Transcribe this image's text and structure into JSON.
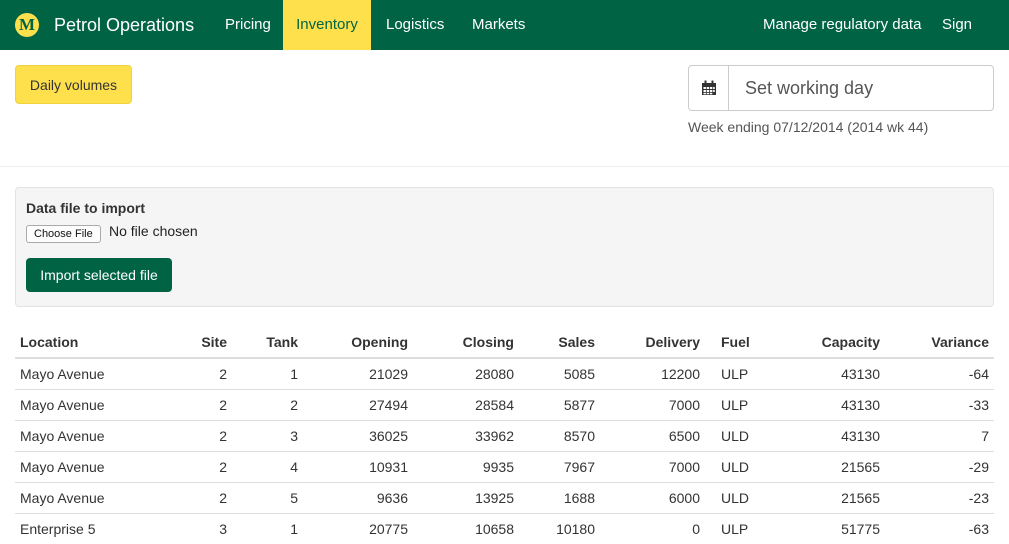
{
  "nav": {
    "logo_letter": "M",
    "brand": "Petrol Operations",
    "items": [
      {
        "label": "Pricing",
        "active": false
      },
      {
        "label": "Inventory",
        "active": true
      },
      {
        "label": "Logistics",
        "active": false
      },
      {
        "label": "Markets",
        "active": false
      }
    ],
    "right": [
      {
        "label": "Manage regulatory data"
      },
      {
        "label": "Sign out"
      }
    ],
    "colors": {
      "bar": "#006444",
      "accent": "#fee04d"
    }
  },
  "toolbar": {
    "daily_volumes_label": "Daily volumes",
    "calendar_icon": "calendar-icon",
    "working_day_placeholder": "Set working day",
    "week_ending": "Week ending 07/12/2014 (2014 wk 44)"
  },
  "import": {
    "label": "Data file to import",
    "choose_file": "Choose File",
    "no_file": "No file chosen",
    "button": "Import selected file"
  },
  "table": {
    "headers": [
      "Location",
      "Site",
      "Tank",
      "Opening",
      "Closing",
      "Sales",
      "Delivery",
      "Fuel",
      "Capacity",
      "Variance"
    ],
    "rows": [
      [
        "Mayo Avenue",
        "2",
        "1",
        "21029",
        "28080",
        "5085",
        "12200",
        "ULP",
        "43130",
        "-64"
      ],
      [
        "Mayo Avenue",
        "2",
        "2",
        "27494",
        "28584",
        "5877",
        "7000",
        "ULP",
        "43130",
        "-33"
      ],
      [
        "Mayo Avenue",
        "2",
        "3",
        "36025",
        "33962",
        "8570",
        "6500",
        "ULD",
        "43130",
        "7"
      ],
      [
        "Mayo Avenue",
        "2",
        "4",
        "10931",
        "9935",
        "7967",
        "7000",
        "ULD",
        "21565",
        "-29"
      ],
      [
        "Mayo Avenue",
        "2",
        "5",
        "9636",
        "13925",
        "1688",
        "6000",
        "ULD",
        "21565",
        "-23"
      ],
      [
        "Enterprise 5",
        "3",
        "1",
        "20775",
        "10658",
        "10180",
        "0",
        "ULP",
        "51775",
        "-63"
      ]
    ]
  }
}
